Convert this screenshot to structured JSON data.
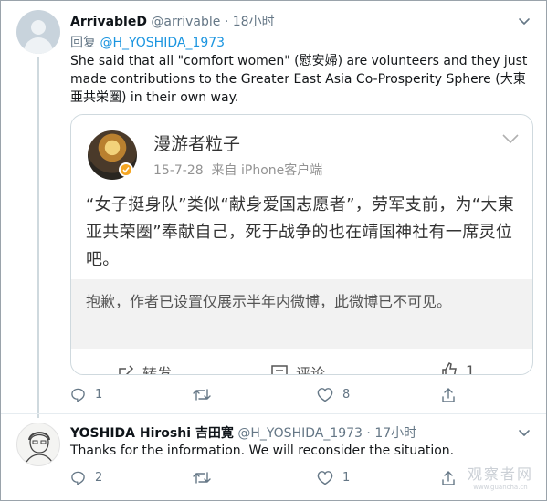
{
  "tweet1": {
    "display_name": "ArrivableD",
    "handle": "@arrivable",
    "separator": "·",
    "time": "18小时",
    "reply_prefix": "回复",
    "reply_handle": "@H_YOSHIDA_1973",
    "text": "She said that all \"comfort women\" (慰安婦) are volunteers and they just made contributions to the Greater East Asia Co-Prosperity Sphere (大東亜共栄圏) in their own way.",
    "actions": {
      "reply_count": "1",
      "retweet_count": "",
      "like_count": "8"
    }
  },
  "quote": {
    "author_name": "漫游者粒子",
    "date": "15-7-28",
    "source": "来自 iPhone客户端",
    "text": "“女子挺身队”类似“献身爱国志愿者”，劳军支前，为“大東亚共荣圈”奉献自己，死于战争的也在靖国神社有一席灵位吧。",
    "notice": "抱歉，作者已设置仅展示半年内微博，此微博已不可见。",
    "actions": {
      "repost_label": "转发",
      "comment_label": "评论",
      "like_count": "1"
    },
    "badge_color": "#f5a623"
  },
  "tweet2": {
    "display_name": "YOSHIDA Hiroshi 吉田寛",
    "handle": "@H_YOSHIDA_1973",
    "separator": "·",
    "time": "17小时",
    "text": "Thanks for the information. We will reconsider the situation.",
    "actions": {
      "reply_count": "2",
      "retweet_count": "",
      "like_count": "1"
    }
  },
  "watermark": {
    "line1": "观察者网",
    "line2": "www.guancha.cn"
  },
  "colors": {
    "link": "#1b95e0",
    "muted": "#657786",
    "thread_line": "#cfd9de"
  }
}
